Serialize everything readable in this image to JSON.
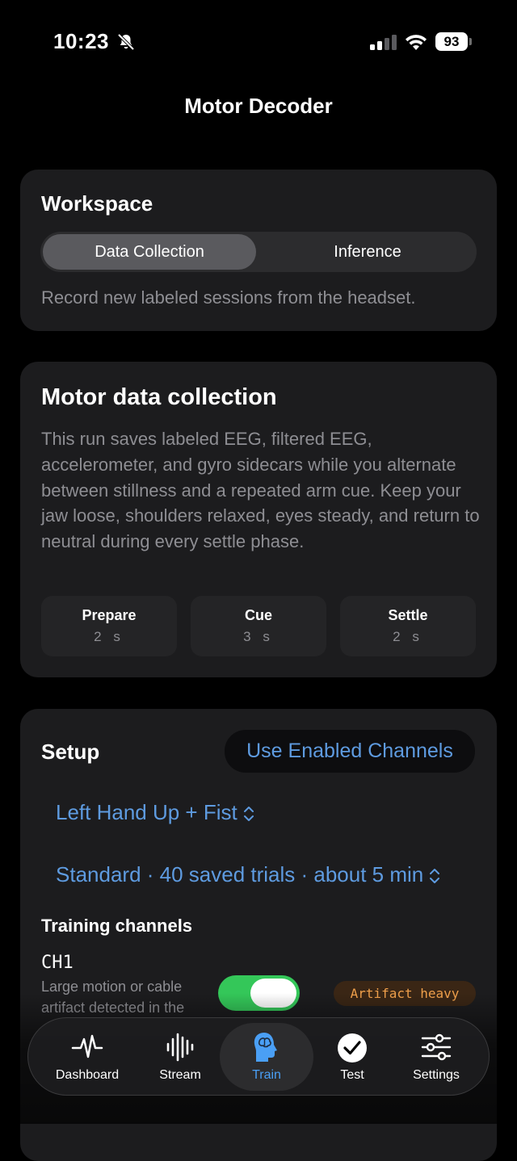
{
  "status_bar": {
    "time": "10:23",
    "battery": "93"
  },
  "nav": {
    "title": "Motor Decoder"
  },
  "workspace": {
    "heading": "Workspace",
    "segments": [
      "Data Collection",
      "Inference"
    ],
    "selected_segment": "Data Collection",
    "description": "Record new labeled sessions from the headset."
  },
  "motor": {
    "heading": "Motor data collection",
    "description": "This run saves labeled EEG, filtered EEG, accelerometer, and gyro sidecars while you alternate between stillness and a repeated arm cue. Keep your jaw loose, shoulders relaxed, eyes steady, and return to neutral during every settle phase.",
    "phases": [
      {
        "name": "Prepare",
        "value": "2 s"
      },
      {
        "name": "Cue",
        "value": "3 s"
      },
      {
        "name": "Settle",
        "value": "2 s"
      }
    ]
  },
  "setup": {
    "heading": "Setup",
    "use_enabled_label": "Use Enabled Channels",
    "movement_picker": "Left Hand Up + Fist",
    "protocol_picker": "Standard · 40 saved trials · about 5 min",
    "channels_heading": "Training channels",
    "channels": [
      {
        "name": "CH1",
        "note": "Large motion or cable artifact detected in the",
        "enabled": true,
        "badge": "Artifact heavy"
      }
    ]
  },
  "tab_bar": {
    "tabs": [
      {
        "label": "Dashboard",
        "icon": "heartbeat-icon"
      },
      {
        "label": "Stream",
        "icon": "waveform-icon"
      },
      {
        "label": "Train",
        "icon": "brain-head-icon"
      },
      {
        "label": "Test",
        "icon": "checkmark-circle-icon"
      },
      {
        "label": "Settings",
        "icon": "sliders-icon"
      }
    ],
    "active": "Train"
  },
  "colors": {
    "background": "#000000",
    "card": "#1c1c1e",
    "accent_blue": "#5e9be0",
    "toggle_green": "#34c759",
    "warning_orange": "#f0a04b",
    "active_tab": "#4a9ff5"
  }
}
